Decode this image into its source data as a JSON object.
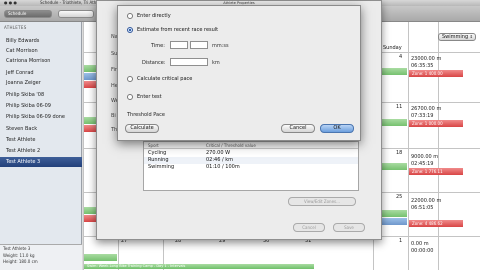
{
  "window": {
    "title_left": "Schedule - Triathlete, Tri Ath 3",
    "title_right": "Triathlete 3"
  },
  "toolbar": {
    "schedule_label": "Schedule"
  },
  "sidebar": {
    "header": "ATHLETES",
    "athletes": [
      "Billy Edwards",
      "Cat Morrison",
      "Catriona Morrison",
      "Jeff Conrad",
      "Joanna Zeiger",
      "Philip Skiba '08",
      "Philip Skiba 06-09",
      "Philip Skiba 06-09 done",
      "Steven Back",
      "Test Athlete",
      "Test Athlete 2",
      "Test Athlete 3"
    ],
    "selected": "Test Athlete 3",
    "footer": {
      "name": "Test Athlete 3",
      "line1": "Weight: 11.0 kg",
      "line2": "Height: 180.0 cm"
    }
  },
  "calendar": {
    "weekday": "Sunday",
    "sport_filter": "Swimming",
    "days_bottom": [
      "27",
      "28",
      "29",
      "30",
      "31"
    ],
    "right_cells": [
      {
        "row": 1,
        "line1": "23000.00 m",
        "line2": "06:35:35",
        "badge": "Zone: 1 400.00"
      },
      {
        "row": 2,
        "line1": "26700.00 m",
        "line2": "07:33:19",
        "badge": "Zone: 1 000.00"
      },
      {
        "row": 3,
        "line1": "9000.00 m",
        "line2": "02:45:19",
        "badge": "Zone: 1 776.11"
      },
      {
        "row": 4,
        "line1": "22000.00 m",
        "line2": "06:51:05",
        "badge": "Zone: 4 486.62"
      },
      {
        "row": 5,
        "line1": "0.00 m",
        "line2": "00:00:00",
        "badge": ""
      }
    ],
    "col3_values": [
      "4",
      "11",
      "18",
      "25",
      "1"
    ],
    "bottom_bar_text": "Swim: Week-Long Bike Training Camp - Day 1 - Intervals"
  },
  "athlete_properties": {
    "title": "Athlete Properties",
    "labels": [
      "Name",
      "Su",
      "Fir",
      "He",
      "We",
      "Bi",
      "Th"
    ],
    "zones_table": {
      "columns": [
        "Sport",
        "Critical / Threshold value"
      ],
      "rows": [
        {
          "sport": "Cycling",
          "value": "270.00 W"
        },
        {
          "sport": "Running",
          "value": "02:46 / km"
        },
        {
          "sport": "Swimming",
          "value": "01:10 / 100m"
        }
      ]
    },
    "view_zones_label": "View/Edit Zones...",
    "cancel_label": "Cancel",
    "save_label": "Save"
  },
  "pace_dialog": {
    "options": [
      {
        "label": "Enter directly",
        "selected": false
      },
      {
        "label": "Estimate from recent race result",
        "selected": true
      },
      {
        "label": "Calculate critical pace",
        "selected": false
      },
      {
        "label": "Enter test",
        "selected": false
      }
    ],
    "time_label": "Time:",
    "time_unit": "mm:ss",
    "distance_label": "Distance:",
    "distance_unit": "km",
    "threshold_label": "Threshold Pace",
    "calculate_label": "Calculate",
    "cancel_label": "Cancel",
    "ok_label": "OK"
  }
}
